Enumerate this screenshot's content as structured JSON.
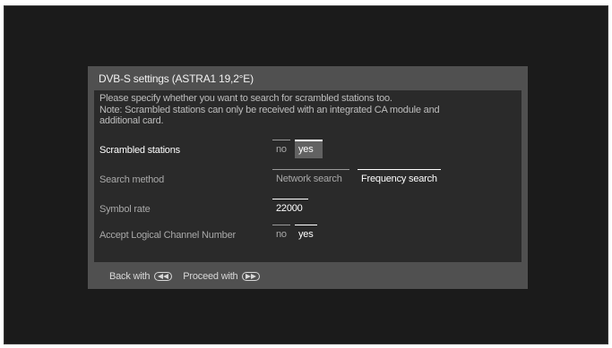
{
  "dialog": {
    "title": "DVB-S settings (ASTRA1 19,2°E)"
  },
  "note": {
    "line1": "Please specify whether you want to search for scrambled stations too.",
    "line2": "Note: Scrambled stations can only be received with an integrated CA module and",
    "line3": "additional card."
  },
  "settings": {
    "scrambled": {
      "label": "Scrambled stations",
      "option_no": "no",
      "option_yes": "yes",
      "selected": "yes"
    },
    "search_method": {
      "label": "Search method",
      "option_network": "Network search",
      "option_frequency": "Frequency search",
      "selected": "Frequency search"
    },
    "symbol_rate": {
      "label": "Symbol rate",
      "value": "22000"
    },
    "lcn": {
      "label": "Accept Logical Channel Number",
      "option_no": "no",
      "option_yes": "yes",
      "selected": "yes"
    }
  },
  "footer": {
    "back_label": "Back with",
    "back_icon": "rewind-button-icon",
    "proceed_label": "Proceed with",
    "proceed_icon": "fast-forward-button-icon"
  },
  "colors": {
    "screen_bg": "#1b1b1b",
    "dialog_bg": "#505050",
    "content_bg": "#2a2a2a",
    "highlight": "#626262"
  }
}
